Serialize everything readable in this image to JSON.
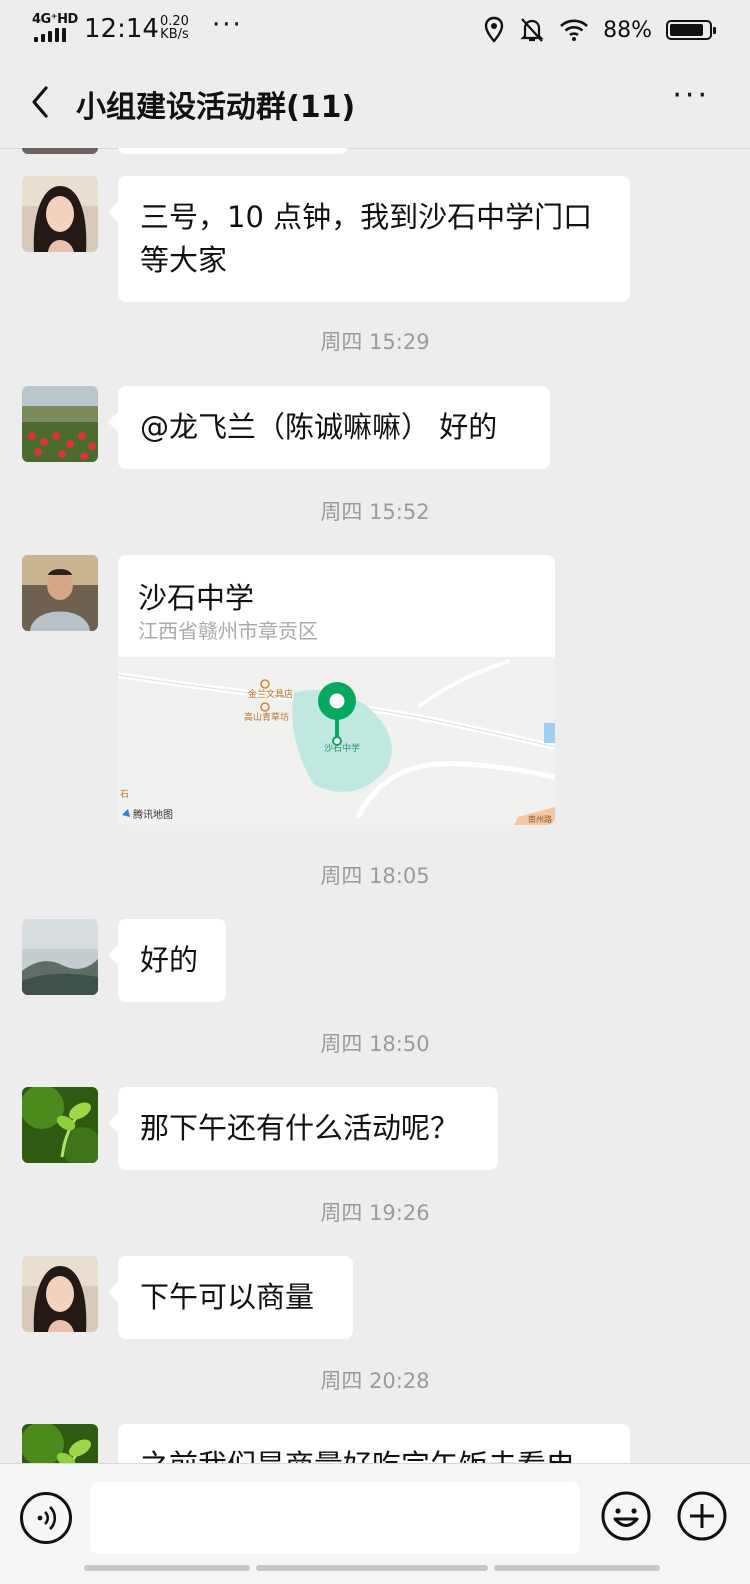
{
  "status_bar": {
    "network": "4G⁺HD",
    "time": "12:14",
    "speed_value": "0.20",
    "speed_unit": "KB/s",
    "more": "···",
    "battery_pct": "88%",
    "battery_level": 0.88
  },
  "nav": {
    "title": "小组建设活动群(11)",
    "more": "···"
  },
  "messages": [
    {
      "text": "三号，10 点钟，我到沙石中学门口等大家"
    },
    {
      "time": "周四 15:29",
      "text": "@龙飞兰（陈诚嘛嘛） 好的"
    },
    {
      "time": "周四 15:52",
      "location_name": "沙石中学",
      "location_addr": "江西省赣州市章贡区",
      "map_labels": {
        "poi1": "金兰文具店",
        "poi2": "高山青草坊",
        "school": "沙石中学",
        "brand": "腾讯地图",
        "edge": "石",
        "road": "南州路"
      }
    },
    {
      "time": "周四 18:05",
      "text": "好的"
    },
    {
      "time": "周四 18:50",
      "text": "那下午还有什么活动呢？"
    },
    {
      "time": "周四 19:26",
      "text": "下午可以商量"
    },
    {
      "time": "周四 20:28",
      "text": "之前我们是商量好吃完午饭去看电"
    }
  ],
  "colors": {
    "background": "#ededed",
    "bubble": "#ffffff",
    "map_pin": "#07a85f",
    "timestamp": "#9b9b9b"
  }
}
